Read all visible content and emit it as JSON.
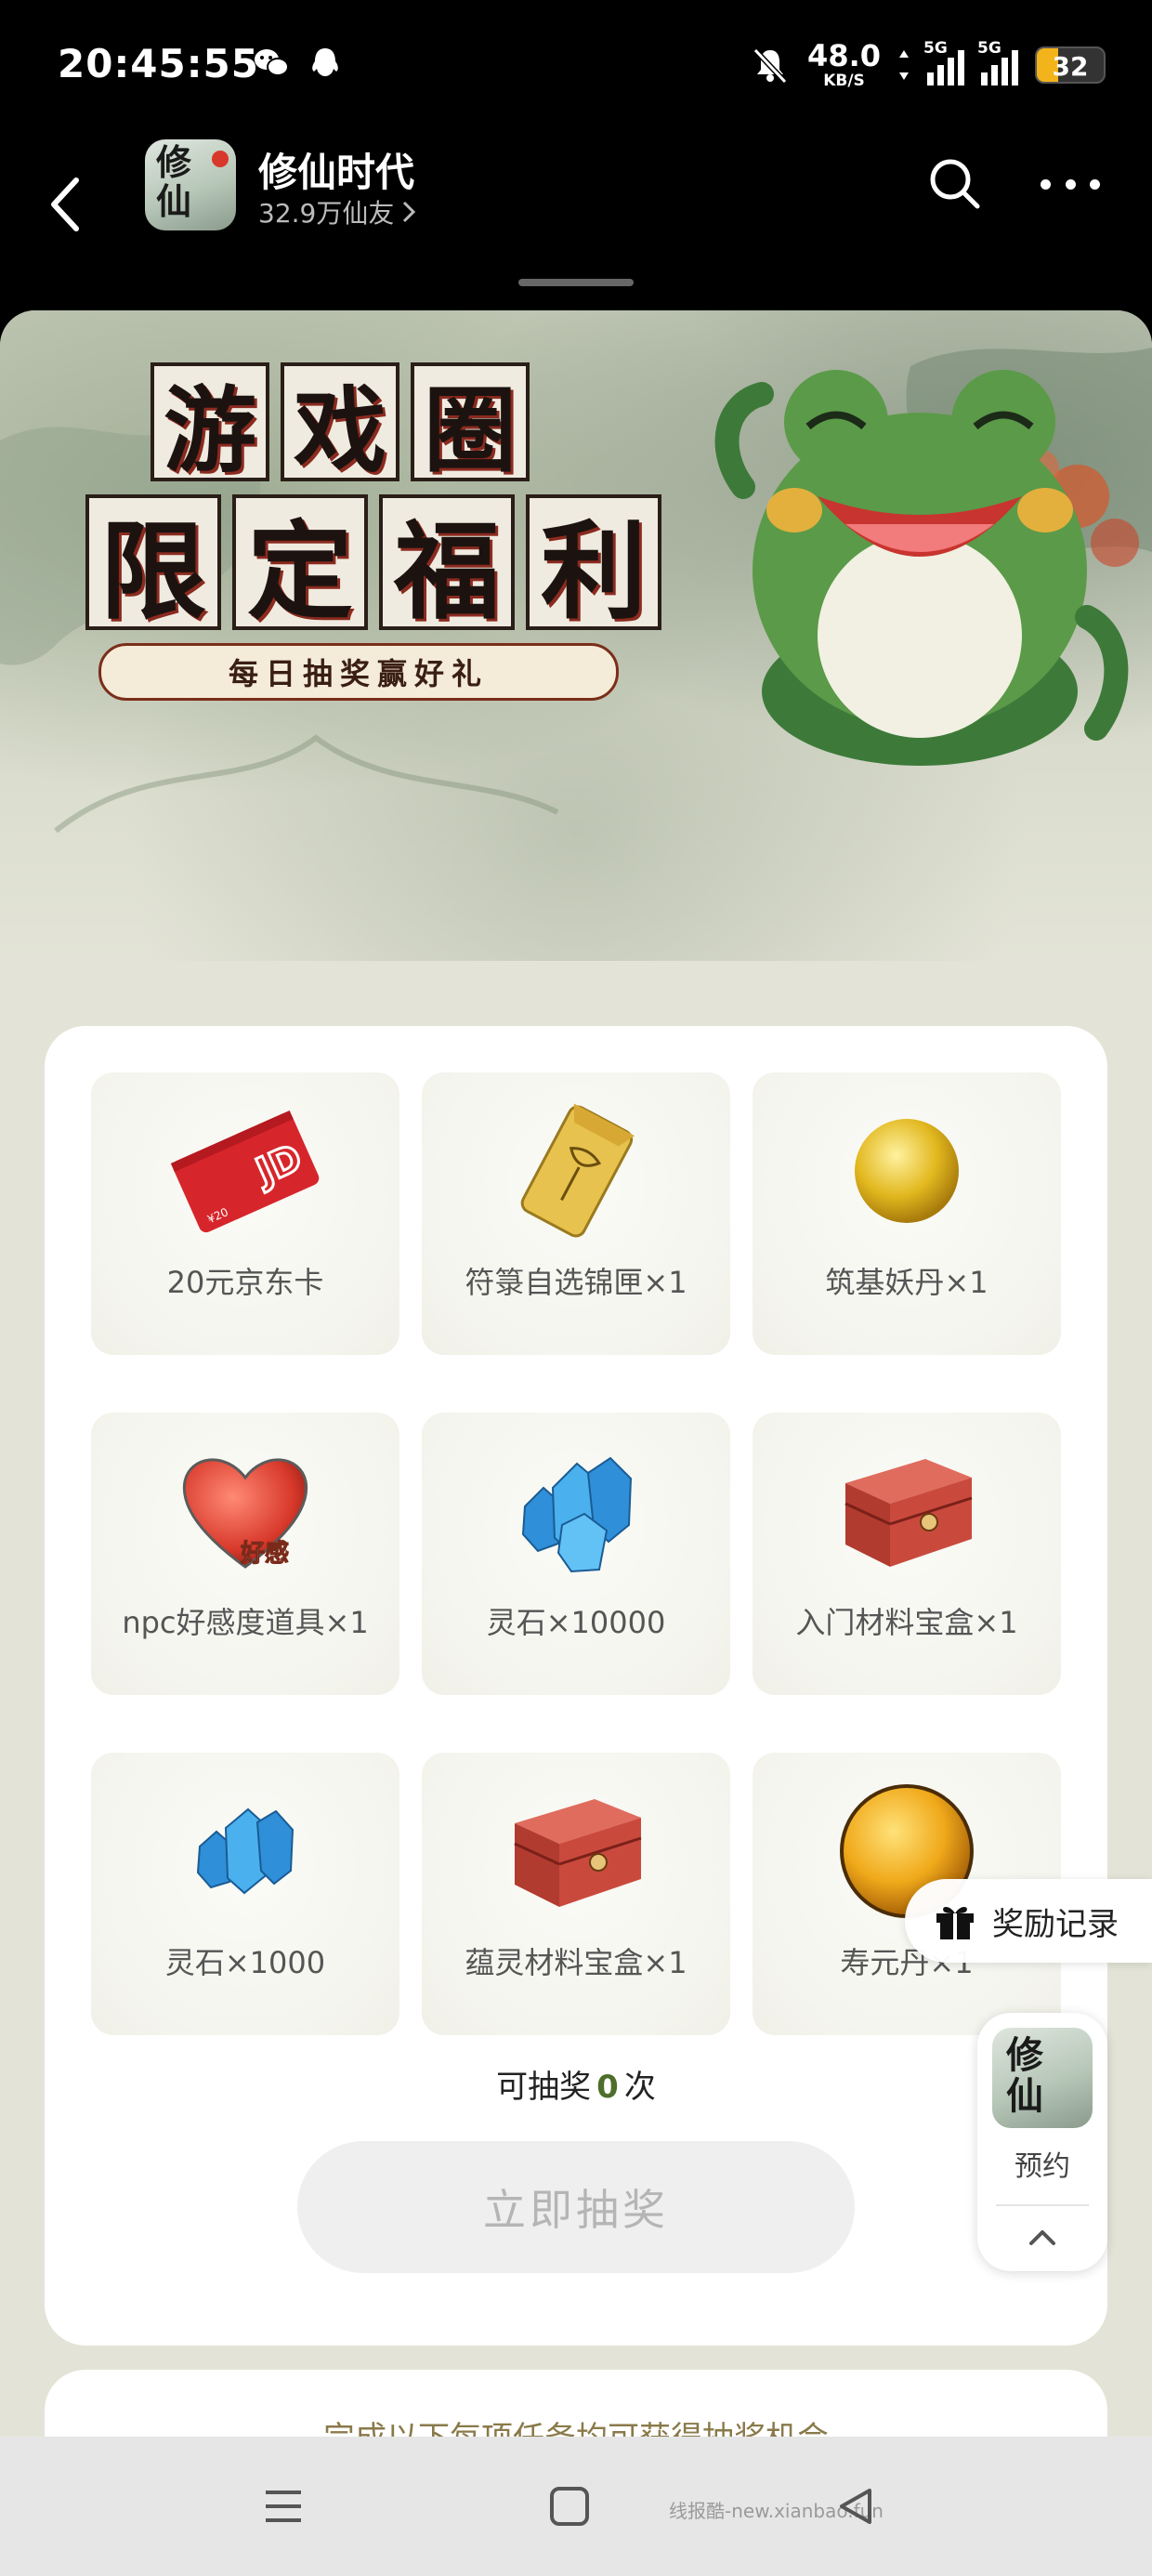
{
  "status_bar": {
    "time": "20:45:55",
    "net_speed_value": "48.0",
    "net_speed_unit": "KB/S",
    "signal1_tag": "5G",
    "signal2_tag": "5G",
    "battery": "32",
    "battery_level": 0.32,
    "icons": [
      "wechat-icon",
      "qq-icon",
      "bell-muted-icon",
      "data-arrows-icon"
    ]
  },
  "header": {
    "app_name": "修仙时代",
    "followers": "32.9万仙友",
    "app_icon_glyph": "修仙"
  },
  "banner": {
    "title_line1": [
      "游",
      "戏",
      "圈"
    ],
    "title_line2": [
      "限",
      "定",
      "福",
      "利"
    ],
    "subtitle": "每日抽奖赢好礼"
  },
  "prizes": [
    {
      "label": "20元京东卡",
      "icon": "jd-card-icon"
    },
    {
      "label": "符箓自选锦匣×1",
      "icon": "talisman-pouch-icon"
    },
    {
      "label": "筑基妖丹×1",
      "icon": "gold-pill-icon"
    },
    {
      "label": "npc好感度道具×1",
      "icon": "heart-icon"
    },
    {
      "label": "灵石×10000",
      "icon": "crystal-large-icon"
    },
    {
      "label": "入门材料宝盒×1",
      "icon": "red-box-icon"
    },
    {
      "label": "灵石×1000",
      "icon": "crystal-small-icon"
    },
    {
      "label": "蕴灵材料宝盒×1",
      "icon": "red-box-icon"
    },
    {
      "label": "寿元丹×1",
      "icon": "orange-pill-icon"
    }
  ],
  "jd_card_text": "JD",
  "heart_tag": "好感",
  "draw": {
    "prefix": "可抽奖",
    "count": "0",
    "suffix": "次",
    "button": "立即抽奖"
  },
  "tasks": {
    "hint": "完成以下每项任务均可获得抽奖机会"
  },
  "floating": {
    "reward_record": "奖励记录",
    "reserve_label": "预约"
  },
  "navbar": {
    "watermark": "线报酷-new.xianbao.fun"
  },
  "colors": {
    "accent_green": "#4e6e2a",
    "battery": "#f2b31b",
    "card_bg": "#ffffff",
    "page_bg": "#e3e4d7"
  }
}
